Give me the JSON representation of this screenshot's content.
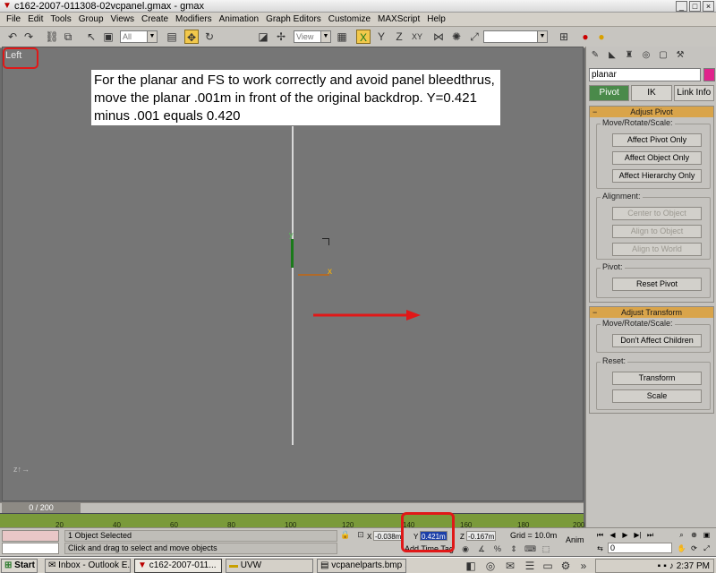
{
  "window": {
    "title": "c162-2007-011308-02vcpanel.gmax - gmax"
  },
  "menu": [
    "File",
    "Edit",
    "Tools",
    "Group",
    "Views",
    "Create",
    "Modifiers",
    "Animation",
    "Graph Editors",
    "Customize",
    "MAXScript",
    "Help"
  ],
  "toolbar": {
    "selection_filter": "All",
    "ref_coord": "View",
    "named_selection": "",
    "axis_x": "X",
    "axis_y": "Y",
    "axis_xy": "XY",
    "axis_z": "Z"
  },
  "viewport": {
    "label": "Left",
    "note": "For the planar and FS to work correctly and avoid panel bleedthrus, move the planar .001m in front of the original backdrop.  Y=0.421 minus .001 equals 0.420",
    "axis_y_label": "y",
    "axis_x_label": "x"
  },
  "command_panel": {
    "object_name": "planar",
    "object_color": "#e0248c",
    "tabs": {
      "pivot": "Pivot",
      "ik": "IK",
      "link_info": "Link Info"
    },
    "adjust_pivot": {
      "title": "Adjust Pivot",
      "move_group": "Move/Rotate/Scale:",
      "affect_pivot": "Affect Pivot Only",
      "affect_object": "Affect Object Only",
      "affect_hierarchy": "Affect Hierarchy Only",
      "alignment_group": "Alignment:",
      "center_to_object": "Center to Object",
      "align_to_object": "Align to Object",
      "align_to_world": "Align to World",
      "pivot_group": "Pivot:",
      "reset_pivot": "Reset Pivot"
    },
    "adjust_transform": {
      "title": "Adjust Transform",
      "move_group": "Move/Rotate/Scale:",
      "dont_affect_children": "Don't Affect Children",
      "reset_group": "Reset:",
      "transform": "Transform",
      "scale": "Scale"
    }
  },
  "timeline": {
    "frame_display": "0 / 200",
    "ticks": [
      "20",
      "40",
      "60",
      "80",
      "100",
      "120",
      "140",
      "160",
      "180",
      "200"
    ]
  },
  "status": {
    "selection": "1 Object Selected",
    "prompt": "Click and drag to select and move objects",
    "x_label": "X",
    "x_value": "-0.038m",
    "y_label": "Y",
    "y_value": "0.421m",
    "z_label": "Z",
    "z_value": "-0.167m",
    "grid": "Grid = 10.0m",
    "add_time_tag": "Add Time Tag",
    "anim": "Anim",
    "frame": "0"
  },
  "taskbar": {
    "start": "Start",
    "tasks": [
      "Inbox - Outlook E...",
      "c162-2007-011...",
      "UVW",
      "vcpanelparts.bmp ..."
    ],
    "clock": "2:37 PM"
  },
  "colors": {
    "annotation_red": "#e01818",
    "rollout_header": "#d9a44a",
    "active_tab": "#4a8a4a",
    "trackbar": "#7a9a3a"
  }
}
